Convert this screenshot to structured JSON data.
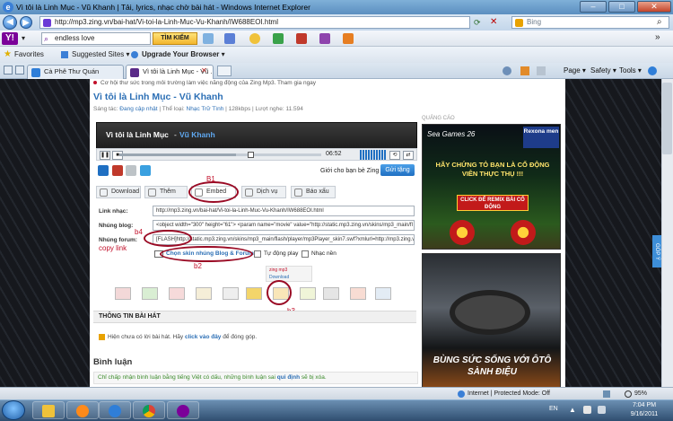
{
  "window": {
    "title": "Vì tôi là Linh Mục - Vũ Khanh | Tải, lyrics, nhạc chờ bài hát - Windows Internet Explorer"
  },
  "addressbar": {
    "url": "http://mp3.zing.vn/bai-hat/Vi-toi-la-Linh-Muc-Vu-Khanh/IW688EOI.html",
    "search_placeholder": "Bing"
  },
  "yahoo": {
    "search_value": "endless love",
    "search_button": "TÌM KIẾM"
  },
  "favorites": {
    "label": "Favorites",
    "suggested": "Suggested Sites ▾",
    "upgrade": "Upgrade Your Browser ▾"
  },
  "tabs": [
    {
      "label": "Cà Phê Thư Quán"
    },
    {
      "label": "Vì tôi là Linh Mục - Vũ ..."
    }
  ],
  "commandbar": {
    "page": "Page ▾",
    "safety": "Safety ▾",
    "tools": "Tools ▾"
  },
  "page": {
    "promo": "Cơ hội thư sức trong môi trường làm việc năng động của Zing Mp3. Tham gia ngay",
    "song_title": "Vì tôi là Linh Mục",
    "artist": "Vũ Khanh",
    "meta": {
      "sangtac_label": "Sáng tác:",
      "sangtac_value": "Đang cập nhật",
      "theloai_label": "Thể loại:",
      "theloai_value": "Nhạc Trữ Tình",
      "bitrate": "128kbps",
      "luotnghe_label": "Lượt nghe:",
      "luotnghe_value": "11.594"
    },
    "player": {
      "title": "Vì tôi là Linh Mục",
      "artist": "Vũ Khanh",
      "time": "06:52"
    },
    "gioi_thieu": "Giới cho bạn bè Zing Me ngay:",
    "gui_tang": "Gửi tặng",
    "action_tabs": [
      {
        "label": "Download"
      },
      {
        "label": "Thêm"
      },
      {
        "label": "Embed"
      },
      {
        "label": "Dịch vụ"
      },
      {
        "label": "Báo xấu"
      }
    ],
    "link_nhac_label": "Link nhạc:",
    "link_nhac_value": "http://mp3.zing.vn/bai-hat/Vi-toi-la-Linh-Muc-Vu-Khanh/IW688EOI.html",
    "nhung_blog_label": "Nhúng blog:",
    "nhung_blog_value": "<object width=\"300\" height=\"61\"> <param name=\"movie\" value=\"http://static.mp3.zing.vn/skins/mp3_main/fl",
    "nhung_forum_label": "Nhúng forum:",
    "nhung_forum_value": "[FLASH]http://static.mp3.zing.vn/skins/mp3_main/flash/player/mp3Player_skin7.swf?xmlurl=http://mp3.zing.vn",
    "chon_skin": "Chọn skin nhúng Blog & Forum",
    "tu_dong_play": "Tự động play",
    "nhac_nen": "Nhạc nền",
    "preview_logo": "zing mp3",
    "preview_download": "Download",
    "thong_tin": "THÔNG TIN BÀI HÁT",
    "lyric_note_pre": "Hiện chưa có lời bài hát. Hãy",
    "lyric_note_link": "click vào đây",
    "lyric_note_post": "để đóng góp.",
    "binh_luan": "Bình luận",
    "binh_luan_note_pre": "Chỉ chấp nhận bình luận bằng tiếng Việt có dấu, những bình luận sai",
    "binh_luan_note_link": "qui định",
    "binh_luan_note_post": "sẽ bị xóa.",
    "quang_cao": "QUẢNG CÁO"
  },
  "annotations": {
    "b1": "B1",
    "b2": "b2",
    "b3": "b3",
    "b4": "b4",
    "copy_link": "copy link"
  },
  "ads": {
    "ad1_brand": "Sea Games 26",
    "ad1_logo": "Rexona men",
    "ad1_headline": "HÃY CHỨNG TỎ BẠN LÀ CỔ ĐỘNG VIÊN THỰC THỤ !!!",
    "ad1_button": "CLICK ĐỂ REMIX BÀI CỔ ĐỘNG",
    "ad2_headline": "BÙNG SỨC SỐNG VỚI ÔTÔ SÀNH ĐIỆU"
  },
  "gopy": "GÓP Ý",
  "statusbar": {
    "zone": "Internet | Protected Mode: Off",
    "zoom": "95%"
  },
  "taskbar": {
    "lang": "EN",
    "time": "7:04 PM",
    "date": "9/16/2011"
  }
}
